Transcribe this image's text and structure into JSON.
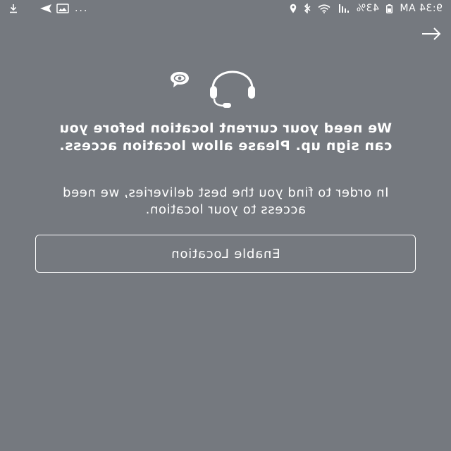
{
  "status_bar": {
    "time": "9:34 AM",
    "battery": "43%",
    "overflow": "..."
  },
  "icons": {
    "back": "arrow-left-icon",
    "illustration_headset": "headset-icon",
    "illustration_bubble": "speech-bubble-eye-icon"
  },
  "content": {
    "headline": "We need your current location before you can sign up. Please allow location access.",
    "description": "In order to find you the best deliveries, we need access to your location.",
    "enable_button_label": "Enable Location"
  },
  "colors": {
    "background": "#75797f",
    "foreground": "#ffffff"
  }
}
